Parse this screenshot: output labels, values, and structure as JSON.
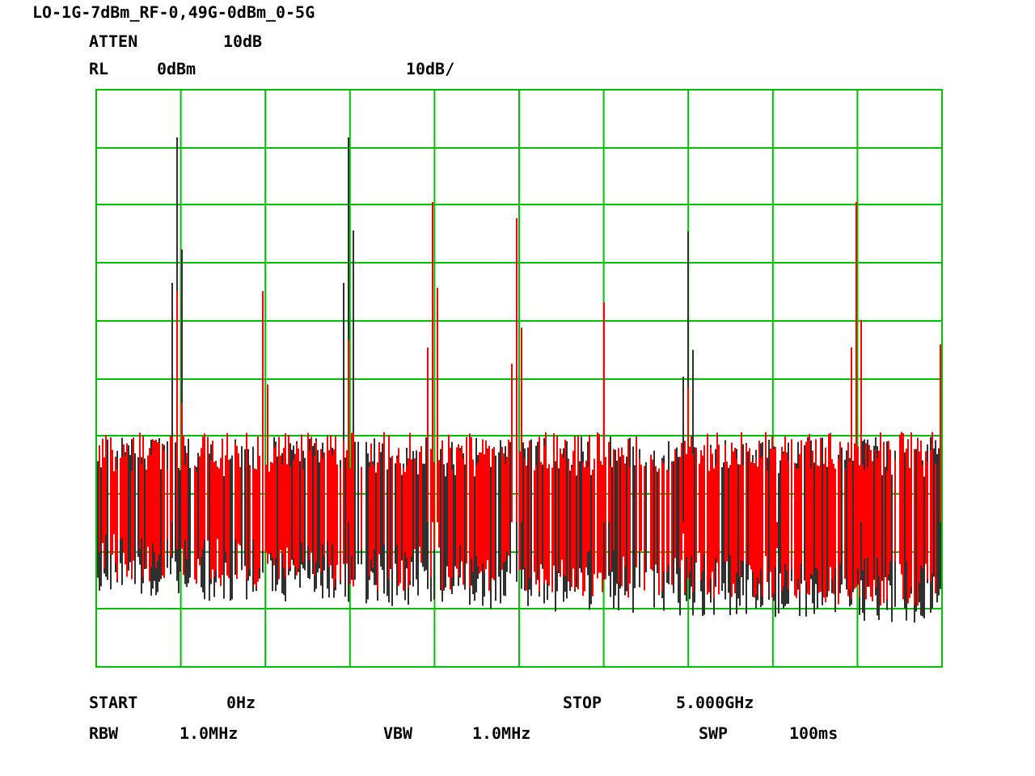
{
  "title": "LO-1G-7dBm_RF-0,49G-0dBm_0-5G",
  "header_rows": [
    [
      "ATTEN",
      "10dB"
    ],
    [
      "RL",
      "0dBm",
      "10dB/"
    ]
  ],
  "plot": {
    "kind": "picture"
  },
  "footer_rows": [
    [
      "START",
      "0Hz",
      "STOP",
      "5.000GHz"
    ],
    [
      "RBW",
      "1.0MHz",
      "VBW",
      "1.0MHz",
      "SWP",
      "100ms"
    ]
  ]
}
